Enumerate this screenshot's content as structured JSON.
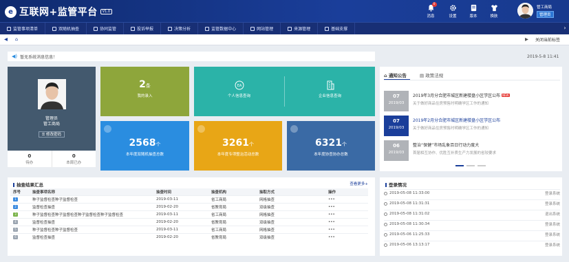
{
  "header": {
    "logo_mark": "e",
    "title": "互联网+监管平台",
    "version": "V1.0",
    "tools": [
      {
        "icon": "bell-icon",
        "label": "消息",
        "badge": "0"
      },
      {
        "icon": "gear-icon",
        "label": "设置"
      },
      {
        "icon": "info-icon",
        "label": "版本"
      },
      {
        "icon": "shirt-icon",
        "label": "换肤"
      }
    ],
    "user": {
      "org": "管工商局",
      "role": "管理员"
    }
  },
  "nav": {
    "items": [
      {
        "label": "监管事项清单",
        "icon": "list-icon"
      },
      {
        "label": "双随机抽查",
        "icon": "shuffle-icon"
      },
      {
        "label": "协同监管",
        "icon": "collab-icon"
      },
      {
        "label": "投诉举报",
        "icon": "report-icon"
      },
      {
        "label": "决策分析",
        "icon": "chart-icon"
      },
      {
        "label": "监管数据中心",
        "icon": "database-icon"
      },
      {
        "label": "网站管理",
        "icon": "monitor-icon"
      },
      {
        "label": "来源管理",
        "icon": "source-icon"
      },
      {
        "label": "基础支撑",
        "icon": "settings-icon"
      }
    ]
  },
  "tabbar": {
    "close_label": "关闭当前标签"
  },
  "notice": {
    "text": "暂无系统消息信息！"
  },
  "datetime": "2019-5-8 11:41",
  "profile": {
    "name": "管理员",
    "dept": "管工商局",
    "pw_label": "修改密码",
    "stats": [
      {
        "value": "0",
        "label": "待办"
      },
      {
        "value": "0",
        "label": "本周已办"
      }
    ]
  },
  "tiles": {
    "my_entry": {
      "value": "2",
      "unit": "条",
      "label": "我的录入",
      "color": "#8ea63b"
    },
    "person_query": {
      "label": "个人信息查询",
      "color": "#2bb3a8"
    },
    "company_query": {
      "label": "企业信息查询",
      "color": "#2bb3a8"
    },
    "random_check": {
      "value": "2568",
      "unit": "个",
      "label": "本年度双随机抽查总数",
      "color": "#2a8de0"
    },
    "special_check": {
      "value": "3261",
      "unit": "个",
      "label": "本年度专项整治活动总数",
      "color": "#e8a616"
    },
    "collab_check": {
      "value": "6321",
      "unit": "个",
      "label": "本年度协查协办总数",
      "color": "#3a6aa5"
    }
  },
  "news": {
    "tabs": [
      "通知公告",
      "政策法规"
    ],
    "items": [
      {
        "day": "07",
        "month": "2019/03",
        "title": "2019年3月分合肥市城区新建楼盘小区学区公布",
        "new": "NEW",
        "body": "关于做好商品住房预售时明确学区工作的通知",
        "color": "#b0b3b8"
      },
      {
        "day": "07",
        "month": "2019/03",
        "title": "2019年2月分合肥市城区新建楼盘小区学区公布",
        "new": "",
        "body": "关于做好商品住房预售时明确学区工作的通知",
        "color": "#1a3e9a"
      },
      {
        "day": "06",
        "month": "2019/03",
        "title": "整治“保健”市场乱象百日行动力度大",
        "new": "",
        "body": "首届相互协作、优胜互补质生产力发展的省较要求",
        "color": "#b0b3b8"
      }
    ]
  },
  "results": {
    "title": "抽查结果汇总",
    "more": "查看更多+",
    "columns": [
      "序号",
      "抽查事项名称",
      "抽查时间",
      "抽查机构",
      "抽取方式",
      "操作"
    ],
    "rows": [
      {
        "no": "1",
        "name": "种子监督检查种子监督检查",
        "date": "2019-03-11",
        "org": "省工商局",
        "mode": "网格抽查",
        "color": "#3b8be0"
      },
      {
        "no": "2",
        "name": "监督检查抽查",
        "date": "2019-02-20",
        "org": "省教育局",
        "mode": "双级抽查",
        "color": "#3b8be0"
      },
      {
        "no": "3",
        "name": "种子监督检查种子监督检查种子监督检查种子监督检查",
        "date": "2019-03-11",
        "org": "省工商局",
        "mode": "网格抽查",
        "color": "#7ab34a"
      },
      {
        "no": "4",
        "name": "监督检查抽查",
        "date": "2019-02-20",
        "org": "省教育局",
        "mode": "双级抽查",
        "color": "#9aa4b0"
      },
      {
        "no": "5",
        "name": "种子监督检查种子监督检查",
        "date": "2019-03-11",
        "org": "省工商局",
        "mode": "网格抽查",
        "color": "#9aa4b0"
      },
      {
        "no": "6",
        "name": "监督检查抽查",
        "date": "2019-02-20",
        "org": "省教育局",
        "mode": "双级抽查",
        "color": "#9aa4b0"
      }
    ],
    "op": "•••"
  },
  "login": {
    "title": "登录情况",
    "rows": [
      {
        "time": "2019-05-08 11:33:00",
        "action": "登录系统"
      },
      {
        "time": "2019-05-08 11:31:31",
        "action": "登录系统"
      },
      {
        "time": "2019-05-08 11:31:02",
        "action": "退出系统"
      },
      {
        "time": "2019-05-08 11:30:34",
        "action": "登录系统"
      },
      {
        "time": "2019-05-06 11:25:33",
        "action": "登录系统"
      },
      {
        "time": "2019-05-06 13:13:17",
        "action": "登录系统"
      }
    ]
  }
}
